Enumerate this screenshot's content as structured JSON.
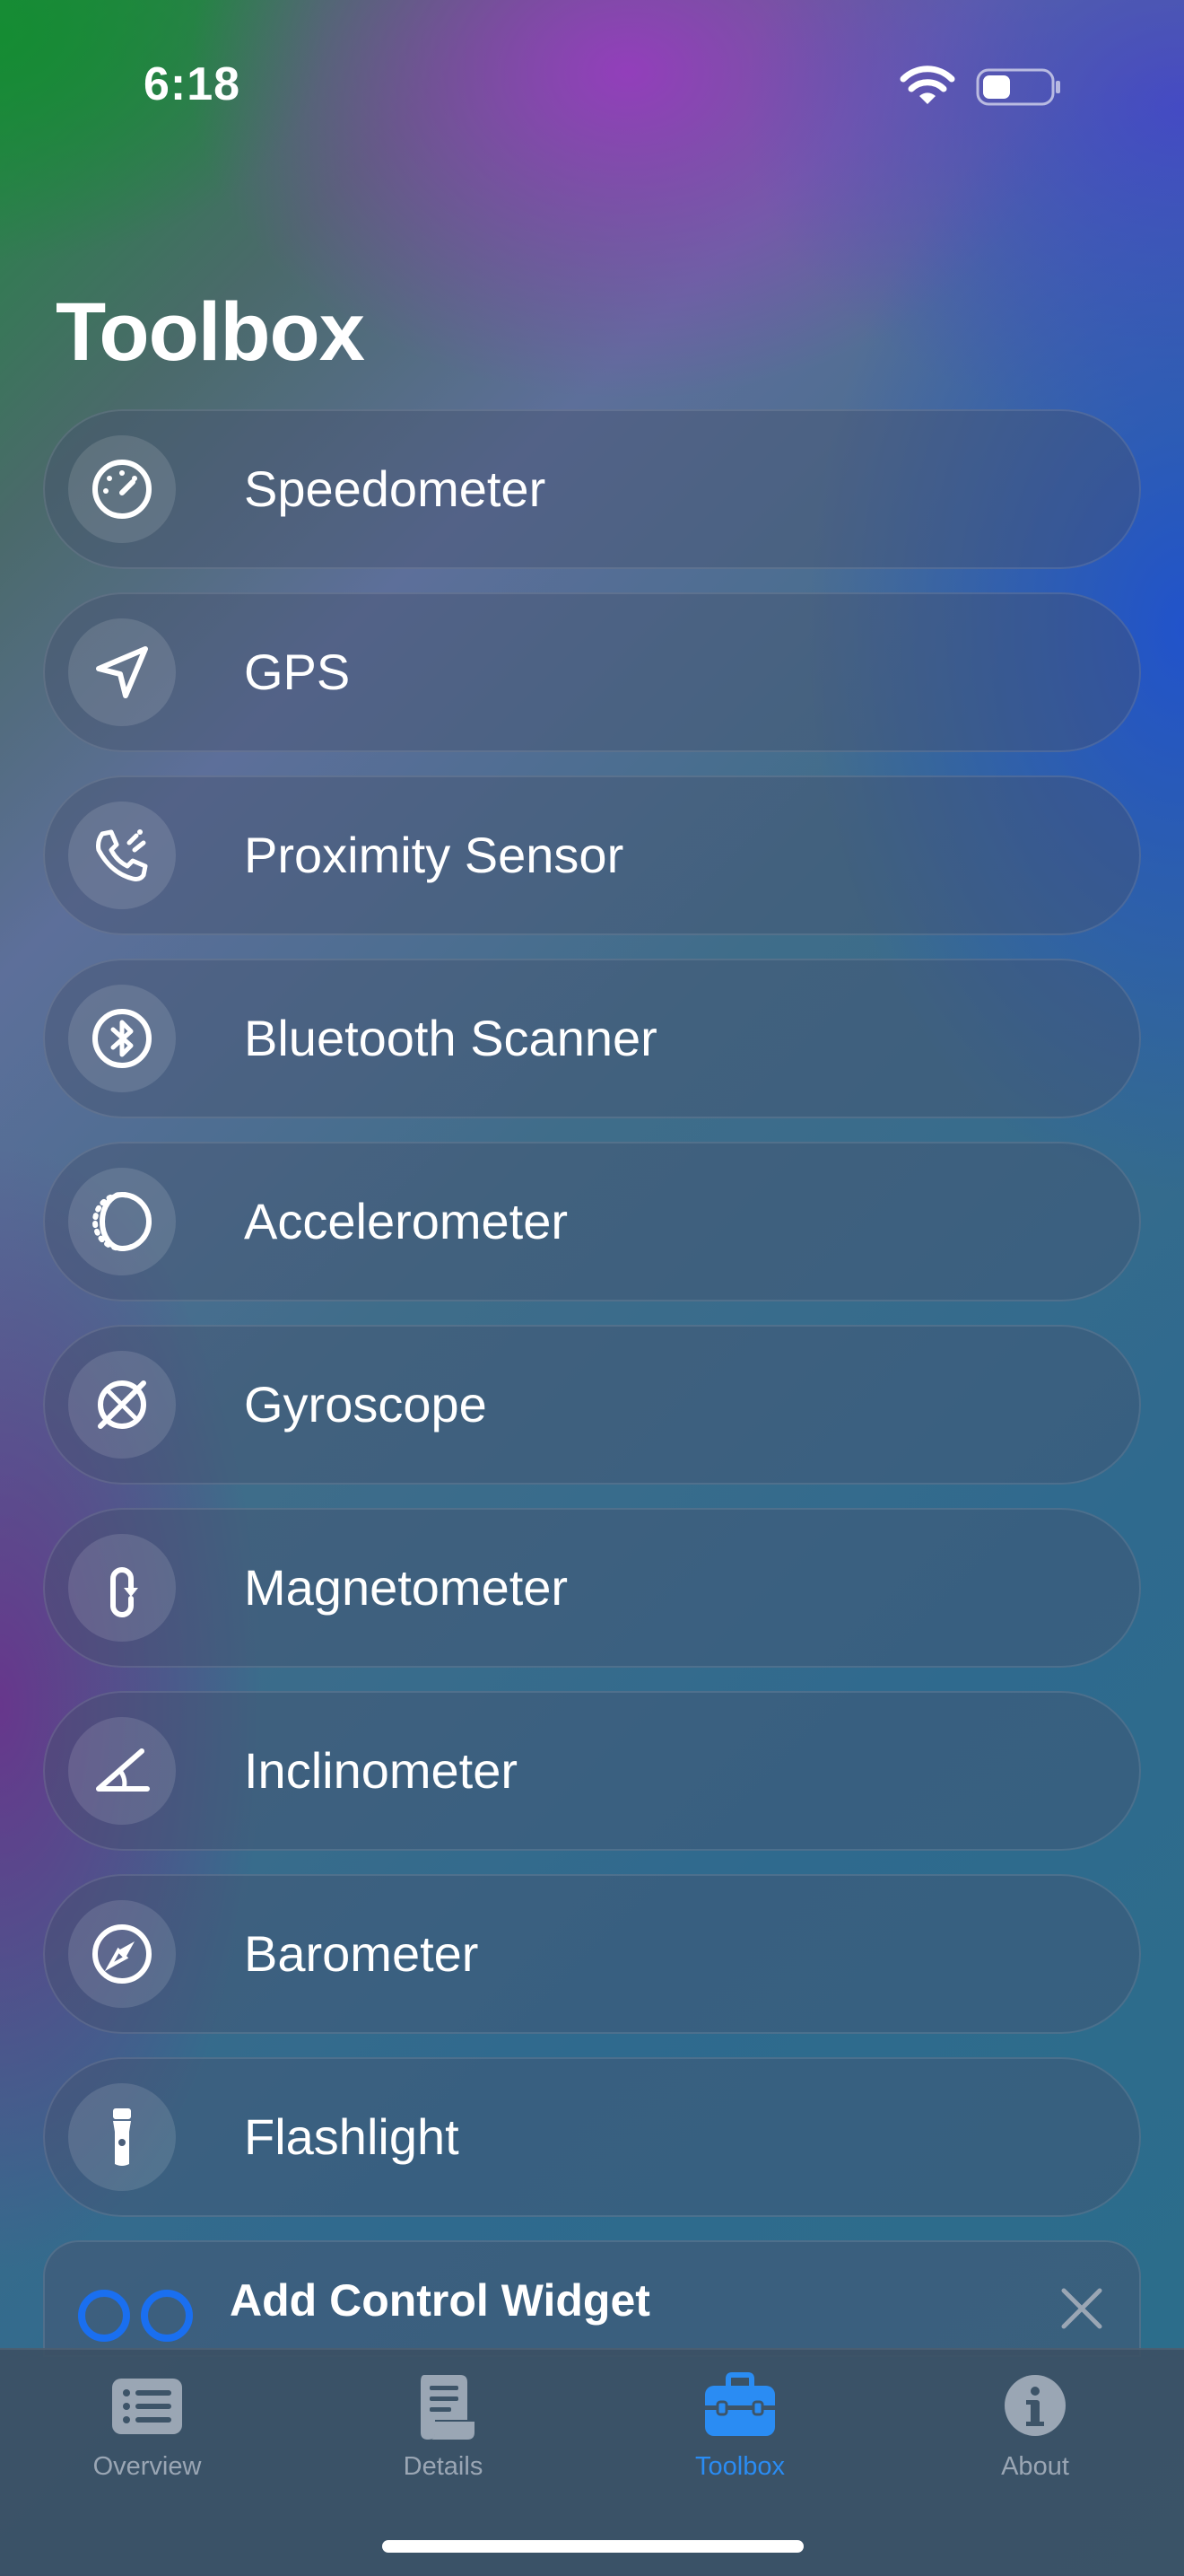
{
  "status": {
    "time": "6:18"
  },
  "header": {
    "title": "Toolbox"
  },
  "tools": [
    {
      "label": "Speedometer",
      "icon": "speedometer-icon"
    },
    {
      "label": "GPS",
      "icon": "location-arrow-icon"
    },
    {
      "label": "Proximity Sensor",
      "icon": "phone-waves-icon"
    },
    {
      "label": "Bluetooth Scanner",
      "icon": "bluetooth-icon"
    },
    {
      "label": "Accelerometer",
      "icon": "dotted-circle-icon"
    },
    {
      "label": "Gyroscope",
      "icon": "gyroscope-icon"
    },
    {
      "label": "Magnetometer",
      "icon": "rotate-arrow-icon"
    },
    {
      "label": "Inclinometer",
      "icon": "angle-icon"
    },
    {
      "label": "Barometer",
      "icon": "compass-icon"
    },
    {
      "label": "Flashlight",
      "icon": "flashlight-icon"
    }
  ],
  "widget_banner": {
    "label": "Add Control Widget"
  },
  "tabs": [
    {
      "label": "Overview",
      "icon": "list-icon",
      "active": false
    },
    {
      "label": "Details",
      "icon": "scroll-icon",
      "active": false
    },
    {
      "label": "Toolbox",
      "icon": "toolbox-icon",
      "active": true
    },
    {
      "label": "About",
      "icon": "info-icon",
      "active": false
    }
  ],
  "colors": {
    "accent": "#2a8cf3",
    "inactive_tab": "#9aa6b4",
    "widget_circles": "#1a6ff0"
  }
}
